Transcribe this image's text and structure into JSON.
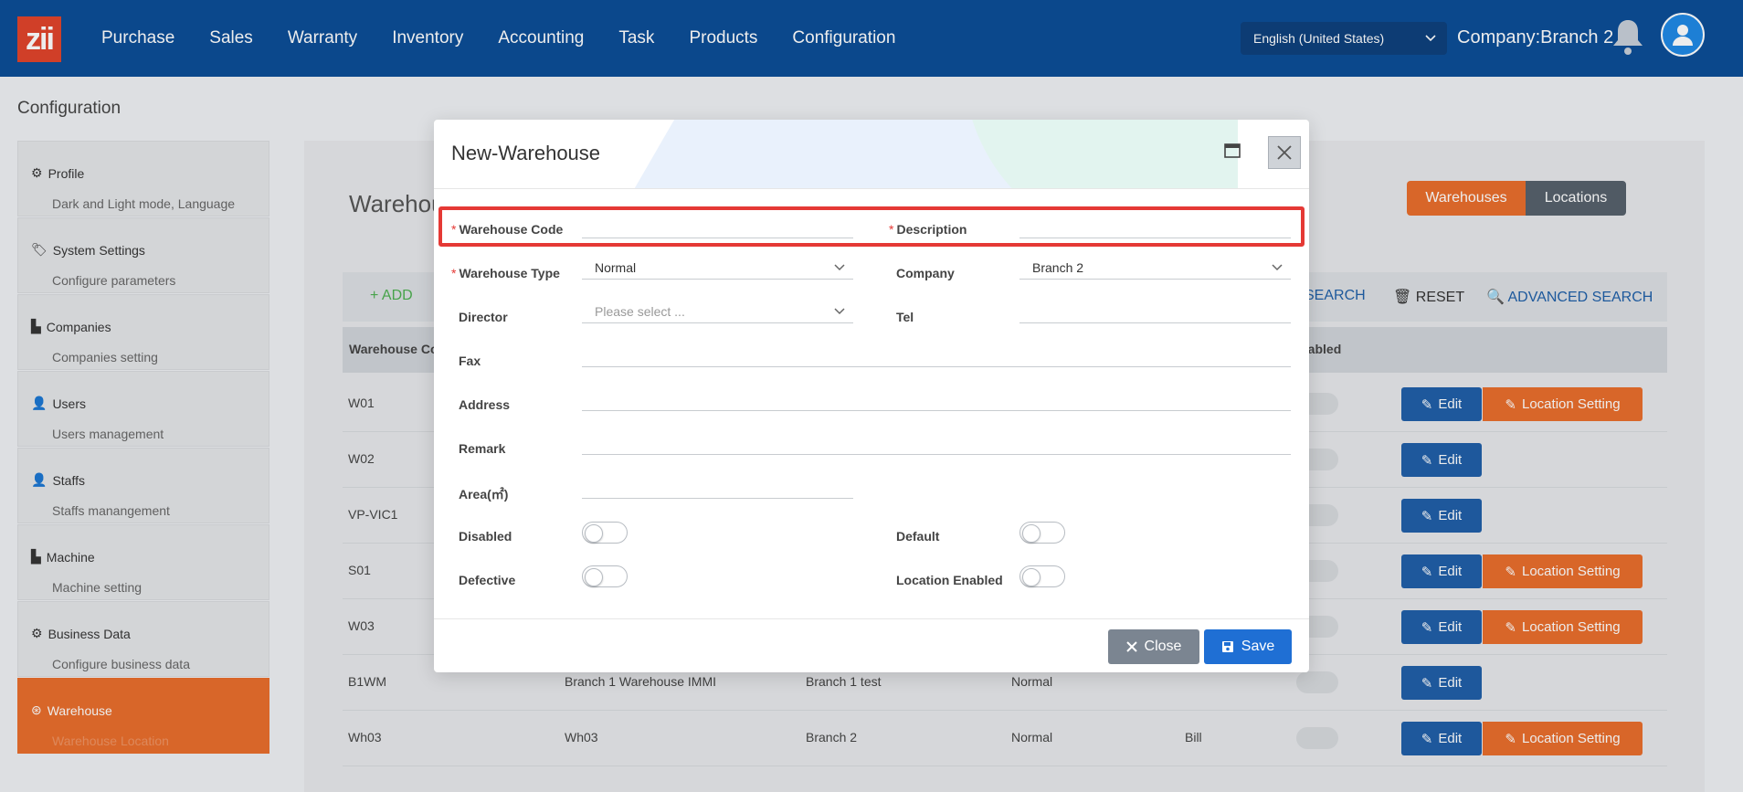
{
  "topbar": {
    "logo": "zii",
    "nav": [
      "Purchase",
      "Sales",
      "Warranty",
      "Inventory",
      "Accounting",
      "Task",
      "Products",
      "Configuration"
    ],
    "language": "English (United States)",
    "company": "Company:Branch 2"
  },
  "breadcrumb": "Configuration",
  "sidebar": [
    {
      "title": "Profile",
      "sub": "Dark and Light mode, Language"
    },
    {
      "title": "System Settings",
      "sub": "Configure parameters"
    },
    {
      "title": "Companies",
      "sub": "Companies setting"
    },
    {
      "title": "Users",
      "sub": "Users management"
    },
    {
      "title": "Staffs",
      "sub": "Staffs manangement"
    },
    {
      "title": "Machine",
      "sub": "Machine setting"
    },
    {
      "title": "Business Data",
      "sub": "Configure business data"
    },
    {
      "title": "Warehouse",
      "sub": "Warehouse Location"
    }
  ],
  "panel": {
    "title": "Warehou",
    "seg_warehouses": "Warehouses",
    "seg_locations": "Locations",
    "add": "ADD",
    "search": "SEARCH",
    "reset": "RESET",
    "advanced_search": "ADVANCED SEARCH",
    "col_code": "Warehouse Co",
    "col_disabled": "isabled",
    "edit": "Edit",
    "location_setting": "Location Setting",
    "rows": [
      {
        "code": "W01",
        "desc": "",
        "company": "",
        "type": "",
        "director": ""
      },
      {
        "code": "W02",
        "desc": "",
        "company": "",
        "type": "",
        "director": ""
      },
      {
        "code": "VP-VIC1",
        "desc": "",
        "company": "",
        "type": "",
        "director": ""
      },
      {
        "code": "S01",
        "desc": "",
        "company": "",
        "type": "",
        "director": ""
      },
      {
        "code": "W03",
        "desc": "",
        "company": "",
        "type": "",
        "director": ""
      },
      {
        "code": "B1WM",
        "desc": "Branch 1 Warehouse IMMI",
        "company": "Branch 1 test",
        "type": "Normal",
        "director": ""
      },
      {
        "code": "Wh03",
        "desc": "Wh03",
        "company": "Branch 2",
        "type": "Normal",
        "director": "Bill"
      }
    ]
  },
  "modal": {
    "title": "New-Warehouse",
    "warehouse_code_label": "Warehouse Code",
    "description_label": "Description",
    "warehouse_type_label": "Warehouse Type",
    "warehouse_type_value": "Normal",
    "company_label": "Company",
    "company_value": "Branch 2",
    "director_label": "Director",
    "director_placeholder": "Please select ...",
    "tel_label": "Tel",
    "fax_label": "Fax",
    "address_label": "Address",
    "remark_label": "Remark",
    "area_label": "Area(㎡)",
    "disabled_label": "Disabled",
    "default_label": "Default",
    "defective_label": "Defective",
    "location_enabled_label": "Location Enabled",
    "close": "Close",
    "save": "Save"
  },
  "colors": {
    "topbar": "#0a4c96",
    "accent": "#e96d2b",
    "primary": "#1f6fd4",
    "highlight": "#e53935"
  }
}
